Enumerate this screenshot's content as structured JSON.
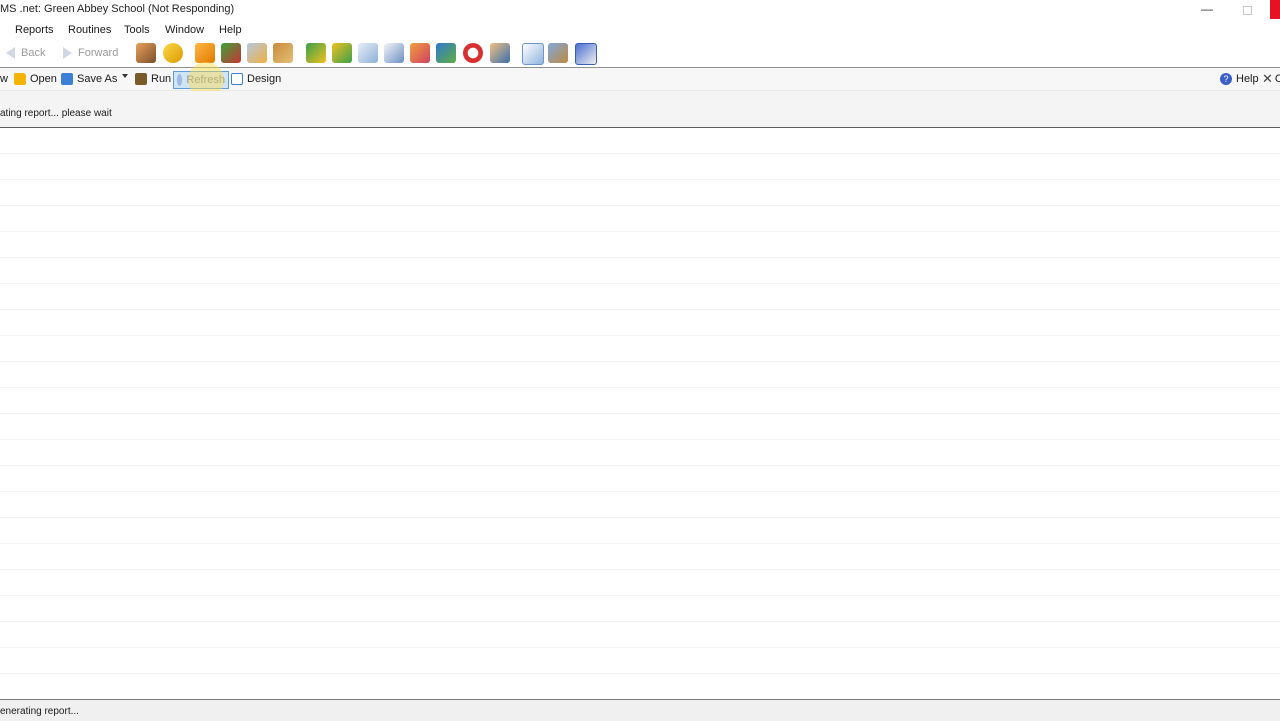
{
  "window": {
    "title": "MS .net: Green Abbey School (Not Responding)",
    "minimize_glyph": "—",
    "close_color": "#e81123"
  },
  "menu": {
    "items": [
      {
        "label": "Reports"
      },
      {
        "label": "Routines"
      },
      {
        "label": "Tools"
      },
      {
        "label": "Window"
      },
      {
        "label": "Help"
      }
    ]
  },
  "nav": {
    "back_label": "Back",
    "forward_label": "Forward",
    "icons": [
      "students-icon",
      "lightbulb-icon",
      "book-icon",
      "flag-icon",
      "envelope-icon",
      "library-icon",
      "timetable-icon",
      "grid-icon",
      "notebook-icon",
      "edit-icon",
      "staff-icon",
      "home-icon",
      "clock-icon",
      "user-icon",
      "mail-icon",
      "mailbox-icon",
      "calendar-icon"
    ]
  },
  "toolbar": {
    "edge_label": "w",
    "open_label": "Open",
    "save_as_label": "Save As",
    "run_label": "Run",
    "refresh_label": "Refresh",
    "design_label": "Design",
    "help_label": "Help",
    "close_edge_label": "C"
  },
  "status": {
    "message": "ating report... please wait"
  },
  "statusbar": {
    "text": "enerating report..."
  },
  "colors": {
    "accent": "#3d7fd6",
    "highlight": "#ffdd46"
  }
}
